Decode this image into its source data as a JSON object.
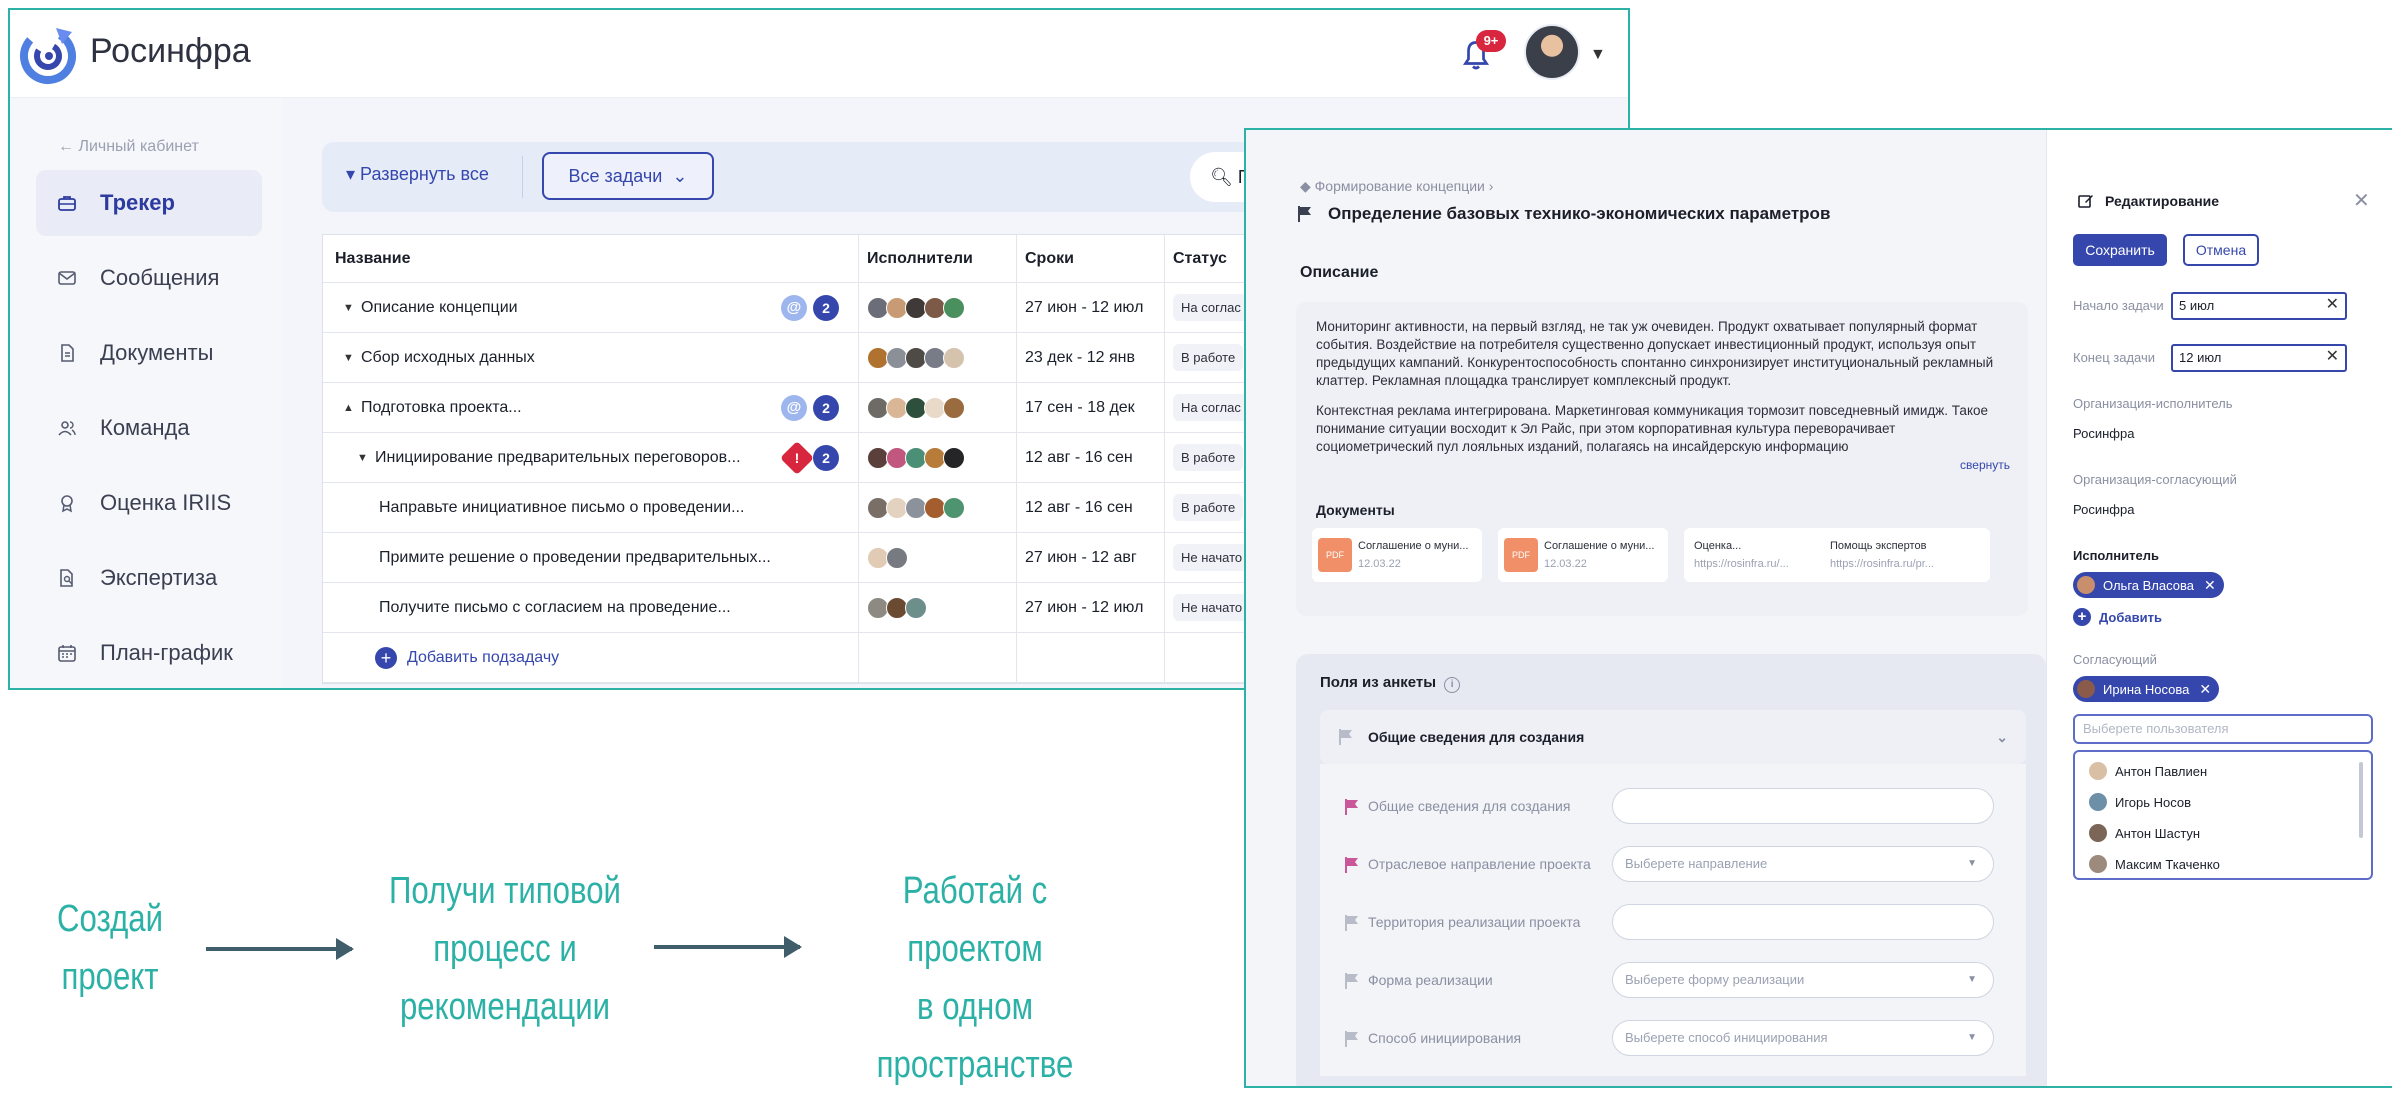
{
  "app": {
    "brand": "Росинфра",
    "notifications_badge": "9+"
  },
  "sidebar": {
    "back_label": "← Личный кабинет",
    "items": [
      {
        "label": "Трекер",
        "active": true
      },
      {
        "label": "Сообщения"
      },
      {
        "label": "Документы"
      },
      {
        "label": "Команда"
      },
      {
        "label": "Оценка IRIIS"
      },
      {
        "label": "Экспертиза"
      },
      {
        "label": "План-график"
      }
    ]
  },
  "toolbar": {
    "expand_all": "Развернуть все",
    "filter_label": "Все задачи",
    "search_placeholder": "П"
  },
  "tracker_table": {
    "columns": [
      "Название",
      "Исполнители",
      "Сроки",
      "Статус"
    ],
    "rows": [
      {
        "name": "Описание концепции",
        "dates": "27 июн - 12 июл",
        "status": "На соглас",
        "count": "2",
        "marker": "@"
      },
      {
        "name": "Сбор исходных данных",
        "dates": "23 дек - 12 янв",
        "status": "В работе"
      },
      {
        "name": "Подготовка проекта...",
        "dates": "17 сен - 18 дек",
        "status": "На соглас",
        "count": "2",
        "marker": "@"
      },
      {
        "name": "Инициирование предварительных переговоров...",
        "dates": "12 авг - 16 сен",
        "status": "В работе",
        "count": "2",
        "marker": "!"
      },
      {
        "name": "Направьте инициативное письмо о проведении...",
        "dates": "12 авг - 16 сен",
        "status": "В работе"
      },
      {
        "name": "Примите решение о проведении предварительных...",
        "dates": "27 июн - 12 авг",
        "status": "Не начато"
      },
      {
        "name": "Получите письмо с согласием на проведение...",
        "dates": "27 июн - 12 июл",
        "status": "Не начато"
      }
    ],
    "add_subtask": "Добавить подзадачу"
  },
  "flow": {
    "step1": [
      "Создай",
      "проект"
    ],
    "step2": [
      "Получи типовой",
      "процесс и",
      "рекомендации"
    ],
    "step3": [
      "Работай с проектом",
      "в одном",
      "пространстве"
    ]
  },
  "task_card": {
    "breadcrumb": "Формирование концепции",
    "title": "Определение базовых технико-экономических параметров",
    "description_title": "Описание",
    "description_p1": "Мониторинг активности, на первый взгляд, не так уж очевиден. Продукт охватывает популярный формат события. Воздействие на потребителя существенно допускает инвестиционный продукт, используя опыт предыдущих кампаний. Конкурентоспособность спонтанно синхронизирует институциональный рекламный клаттер. Рекламная площадка транслирует комплексный продукт.",
    "description_p2": "Контекстная реклама интегрирована. Маркетинговая коммуникация тормозит повседневный имидж. Такое понимание ситуации восходит к Эл Райс, при этом корпоративная культура переворачивает социометрический пул лояльных изданий, полагаясь на инсайдерскую информацию",
    "collapse_label": "свернуть",
    "documents_title": "Документы",
    "documents": [
      {
        "type": "PDF",
        "name": "Соглашение о муни...",
        "date": "12.03.22"
      },
      {
        "type": "PDF",
        "name": "Соглашение о муни...",
        "date": "12.03.22"
      },
      {
        "type": "link",
        "name": "Оценка...",
        "date": "https://rosinfra.ru/..."
      },
      {
        "type": "link",
        "name": "Помощь экспертов",
        "date": "https://rosinfra.ru/pr..."
      }
    ],
    "fields_title": "Поля из анкеты",
    "group_title": "Общие сведения для создания",
    "fields": [
      {
        "label": "Общие сведения для создания",
        "placeholder": "",
        "flag": "pink"
      },
      {
        "label": "Отраслевое направление проекта",
        "placeholder": "Выберете направление",
        "flag": "pink",
        "dropdown": true
      },
      {
        "label": "Территория реализации проекта",
        "placeholder": "",
        "flag": "grey"
      },
      {
        "label": "Форма реализации",
        "placeholder": "Выберете форму реализации",
        "flag": "grey",
        "dropdown": true
      },
      {
        "label": "Способ инициирования",
        "placeholder": "Выберете способ инициирования",
        "flag": "grey",
        "dropdown": true
      }
    ]
  },
  "edit_panel": {
    "title": "Редактирование",
    "save": "Сохранить",
    "cancel": "Отмена",
    "start_label": "Начало задачи",
    "start_value": "5 июл",
    "end_label": "Конец задачи",
    "end_value": "12 июл",
    "org_exec_label": "Организация-исполнитель",
    "org_exec_value": "Росинфра",
    "org_appr_label": "Организация-согласующий",
    "org_appr_value": "Росинфра",
    "executor_label": "Исполнитель",
    "executor_chip": "Ольга Власова",
    "add_label": "Добавить",
    "approver_label": "Согласующий",
    "approver_chip": "Ирина Носова",
    "user_placeholder": "Выберете пользователя",
    "users": [
      "Антон Павлиен",
      "Игорь Носов",
      "Антон Шастун",
      "Максим Ткаченко"
    ]
  },
  "colors": {
    "accent": "#3547ad",
    "teal": "#2bb1a6",
    "alert": "#d7263d"
  }
}
